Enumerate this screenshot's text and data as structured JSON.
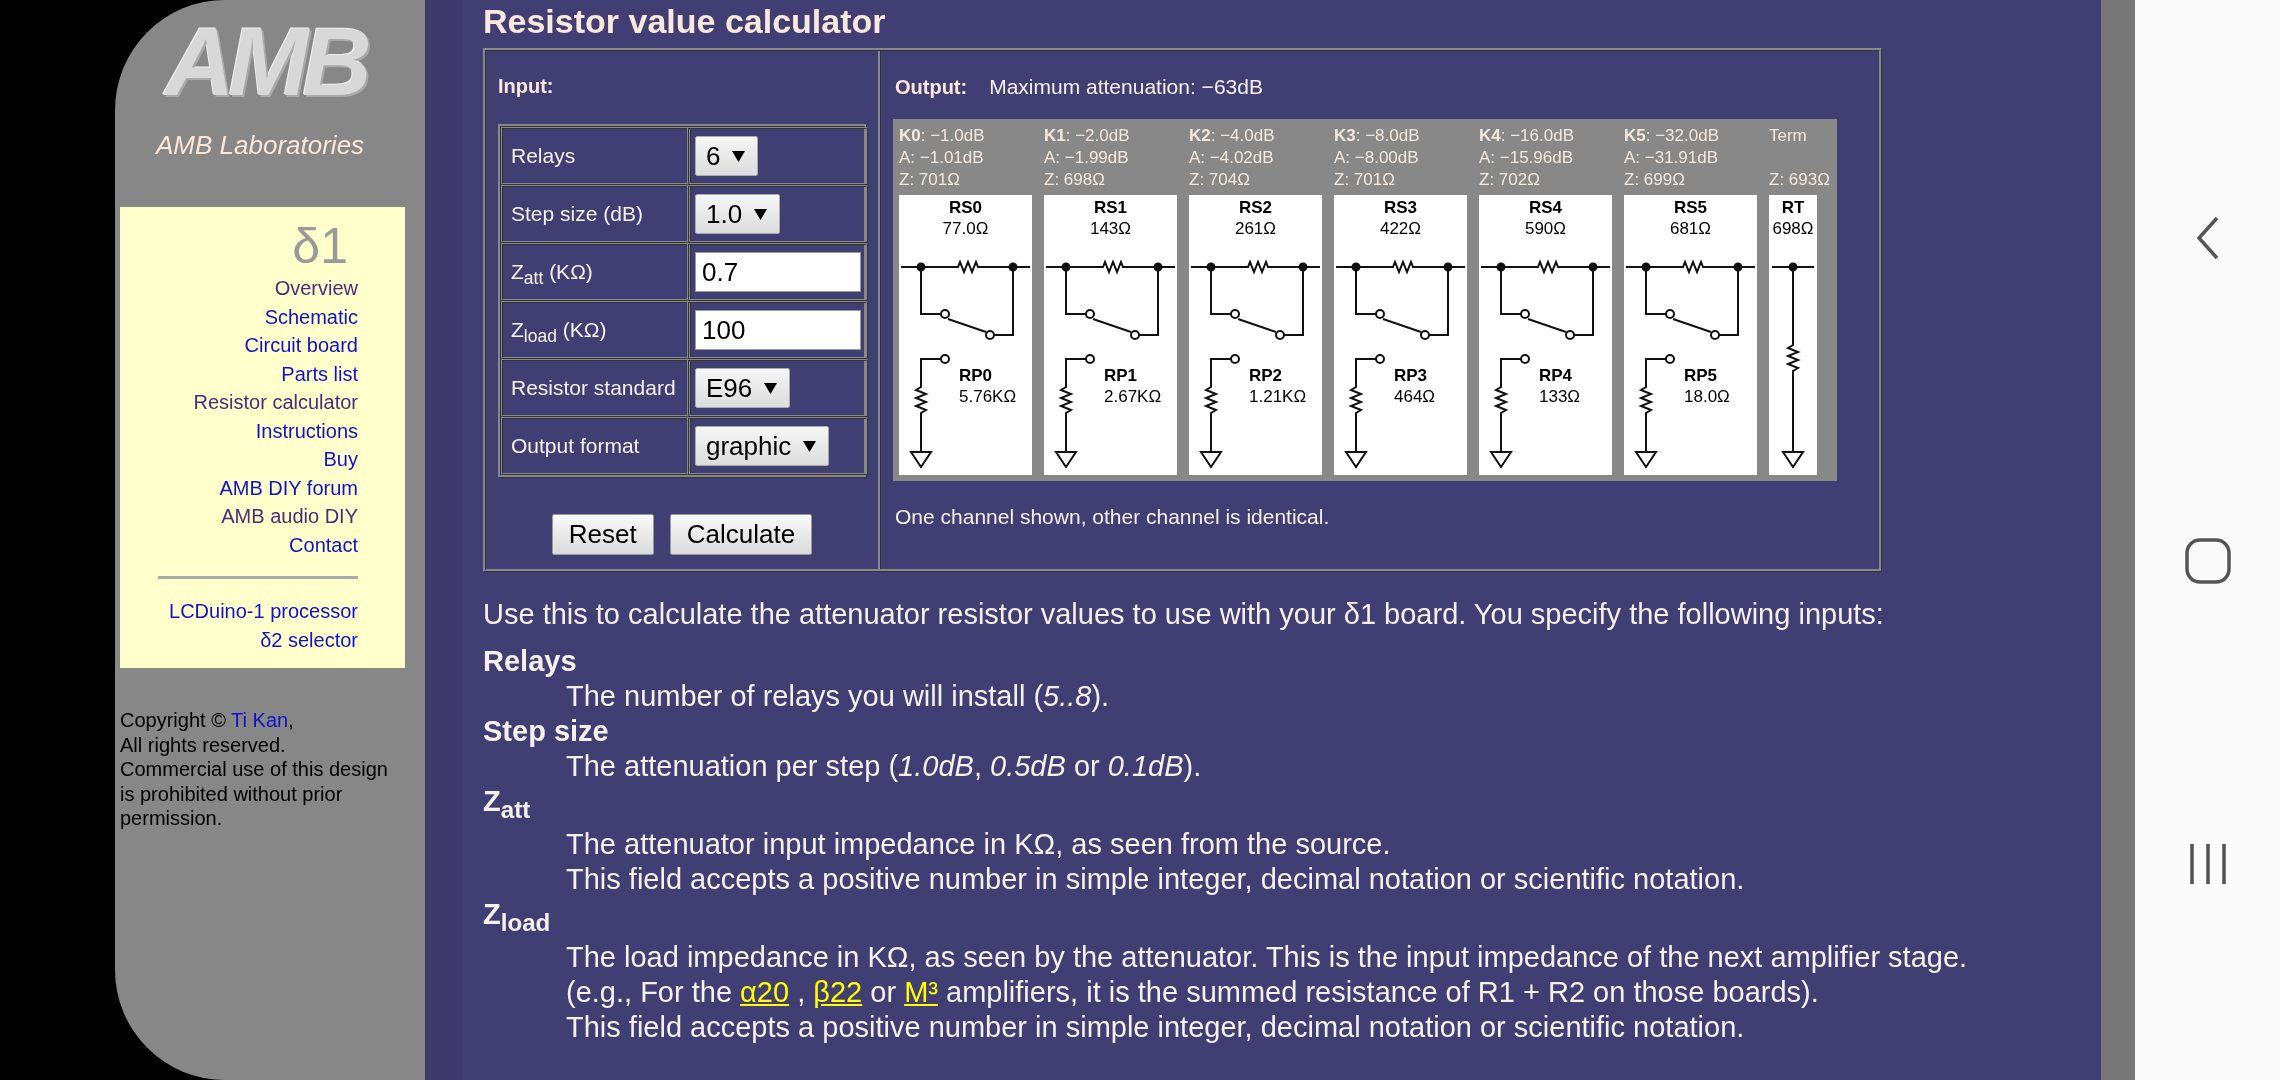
{
  "sidebar": {
    "logo": "AMB",
    "subtitle": "AMB Laboratories",
    "product": "δ1",
    "nav": [
      {
        "label": "Overview",
        "visited": true
      },
      {
        "label": "Schematic",
        "visited": false
      },
      {
        "label": "Circuit board",
        "visited": false
      },
      {
        "label": "Parts list",
        "visited": false
      },
      {
        "label": "Resistor calculator",
        "visited": true
      },
      {
        "label": "Instructions",
        "visited": false
      },
      {
        "label": "Buy",
        "visited": false
      },
      {
        "label": "AMB DIY forum",
        "visited": false
      },
      {
        "label": "AMB audio DIY",
        "visited": true
      },
      {
        "label": "Contact",
        "visited": false
      }
    ],
    "related": [
      {
        "label": "LCDuino-1 processor",
        "visited": false
      },
      {
        "label": "δ2 selector",
        "visited": false
      }
    ],
    "copyright": {
      "before": "Copyright © ",
      "author": "Ti Kan",
      "after": ",",
      "more_lines": [
        "All rights reserved.",
        "Commercial use of this design",
        "is prohibited without prior",
        "permission."
      ]
    }
  },
  "page": {
    "title": "Resistor value calculator",
    "calculator": {
      "input_heading": "Input:",
      "inputs": [
        {
          "label": "Relays",
          "kind": "select",
          "value": "6"
        },
        {
          "label": "Step size (dB)",
          "kind": "select",
          "value": "1.0"
        },
        {
          "label": "Z$_{att}$ (KΩ)",
          "kind": "text",
          "value": "0.7"
        },
        {
          "label": "Z$_{load}$ (KΩ)",
          "kind": "text",
          "value": "100"
        },
        {
          "label": "Resistor standard",
          "kind": "select",
          "value": "E96"
        },
        {
          "label": "Output format",
          "kind": "select",
          "value": "graphic"
        }
      ],
      "buttons": [
        "Reset",
        "Calculate"
      ],
      "output_heading": "Output:",
      "max_attenuation": "Maximum attenuation: −63dB",
      "stages": [
        {
          "kind": "relay",
          "header": "**K0**: −1.0dB",
          "actual": "A: −1.01dB",
          "impedance": "Z: 701Ω",
          "series_name": "RS0",
          "series_value": "77.0Ω",
          "shunt_name": "RP0",
          "shunt_value": "5.76KΩ"
        },
        {
          "kind": "relay",
          "header": "**K1**: −2.0dB",
          "actual": "A: −1.99dB",
          "impedance": "Z: 698Ω",
          "series_name": "RS1",
          "series_value": "143Ω",
          "shunt_name": "RP1",
          "shunt_value": "2.67KΩ"
        },
        {
          "kind": "relay",
          "header": "**K2**: −4.0dB",
          "actual": "A: −4.02dB",
          "impedance": "Z: 704Ω",
          "series_name": "RS2",
          "series_value": "261Ω",
          "shunt_name": "RP2",
          "shunt_value": "1.21KΩ"
        },
        {
          "kind": "relay",
          "header": "**K3**: −8.0dB",
          "actual": "A: −8.00dB",
          "impedance": "Z: 701Ω",
          "series_name": "RS3",
          "series_value": "422Ω",
          "shunt_name": "RP3",
          "shunt_value": "464Ω"
        },
        {
          "kind": "relay",
          "header": "**K4**: −16.0dB",
          "actual": "A: −15.96dB",
          "impedance": "Z: 702Ω",
          "series_name": "RS4",
          "series_value": "590Ω",
          "shunt_name": "RP4",
          "shunt_value": "133Ω"
        },
        {
          "kind": "relay",
          "header": "**K5**: −32.0dB",
          "actual": "A: −31.91dB",
          "impedance": "Z: 699Ω",
          "series_name": "RS5",
          "series_value": "681Ω",
          "shunt_name": "RP5",
          "shunt_value": "18.0Ω"
        },
        {
          "kind": "term",
          "header": "Term",
          "impedance": "Z: 693Ω",
          "series_name": "RT",
          "series_value": "698Ω"
        }
      ],
      "note": "One channel shown, other channel is identical."
    },
    "intro": "Use this to calculate the attenuator resistor values to use with your δ1 board. You specify the following inputs:",
    "definitions": [
      {
        "term": "Relays",
        "lines": [
          [
            {
              "text": "The number of relays you will install (*5..8*)."
            }
          ]
        ]
      },
      {
        "term": "Step size",
        "lines": [
          [
            {
              "text": "The attenuation per step (*1.0dB*, *0.5dB* or *0.1dB*)."
            }
          ]
        ]
      },
      {
        "term": "Z$_{att}$",
        "lines": [
          [
            {
              "text": "The attenuator input impedance in KΩ, as seen from the source."
            }
          ],
          [
            {
              "text": "This field accepts a positive number in simple integer, decimal notation or scientific notation."
            }
          ]
        ]
      },
      {
        "term": "Z$_{load}$",
        "lines": [
          [
            {
              "text": "The load impedance in KΩ, as seen by the attenuator. This is the input impedance of the next amplifier stage."
            }
          ],
          [
            {
              "text": "(e.g., For the "
            },
            {
              "link": "α20"
            },
            {
              "text": " , "
            },
            {
              "link": "β22"
            },
            {
              "text": " or "
            },
            {
              "link": "M³"
            },
            {
              "text": " amplifiers, it is the summed resistance of R1 + R2 on those boards)."
            }
          ],
          [
            {
              "text": "This field accepts a positive number in simple integer, decimal notation or scientific notation."
            }
          ]
        ]
      }
    ]
  }
}
